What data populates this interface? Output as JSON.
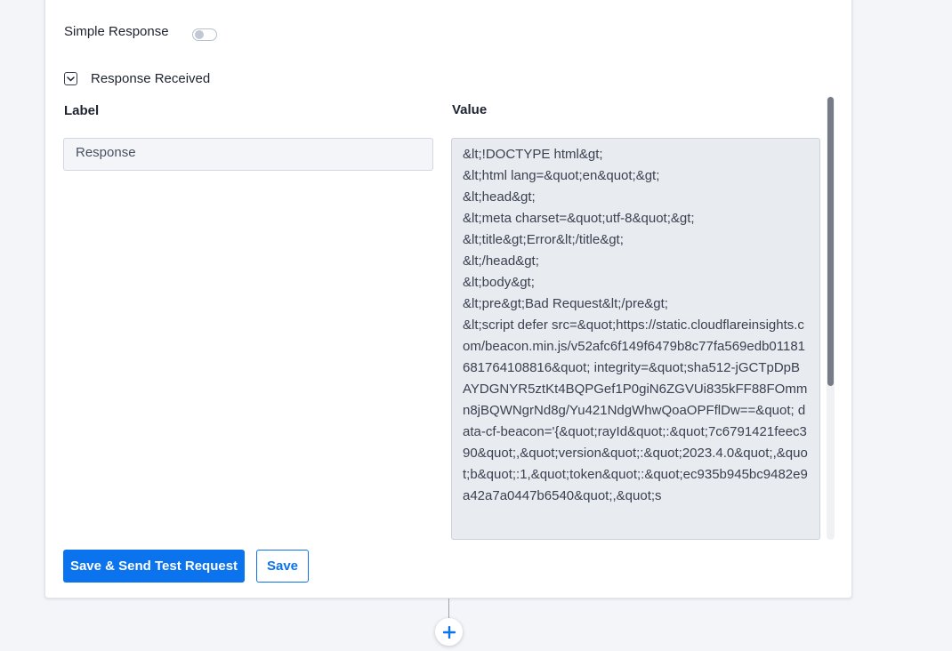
{
  "simple_response": {
    "label": "Simple Response",
    "enabled": false
  },
  "response_received": {
    "label": "Response Received",
    "expanded": true
  },
  "columns": {
    "label_header": "Label",
    "value_header": "Value"
  },
  "label_field": {
    "value": "Response"
  },
  "value_field": {
    "value": "&lt;!DOCTYPE html&gt;\n&lt;html lang=&quot;en&quot;&gt;\n&lt;head&gt;\n&lt;meta charset=&quot;utf-8&quot;&gt;\n&lt;title&gt;Error&lt;/title&gt;\n&lt;/head&gt;\n&lt;body&gt;\n&lt;pre&gt;Bad Request&lt;/pre&gt;\n&lt;script defer src=&quot;https://static.cloudflareinsights.com/beacon.min.js/v52afc6f149f6479b8c77fa569edb01181681764108816&quot; integrity=&quot;sha512-jGCTpDpBAYDGNYR5ztKt4BQPGef1P0giN6ZGVUi835kFF88FOmmn8jBQWNgrNd8g/Yu421NdgWhwQoaOPFflDw==&quot; data-cf-beacon='{&quot;rayId&quot;:&quot;7c6791421feec390&quot;,&quot;version&quot;:&quot;2023.4.0&quot;,&quot;b&quot;:1,&quot;token&quot;:&quot;ec935b945bc9482e9a42a7a0447b6540&quot;,&quot;s"
  },
  "buttons": {
    "save_and_test": "Save & Send Test Request",
    "save": "Save"
  },
  "icons": {
    "chevron": "chevron-down-icon",
    "add": "plus-icon"
  },
  "colors": {
    "accent": "#0b73ee",
    "scroll_thumb": "#767c87"
  }
}
